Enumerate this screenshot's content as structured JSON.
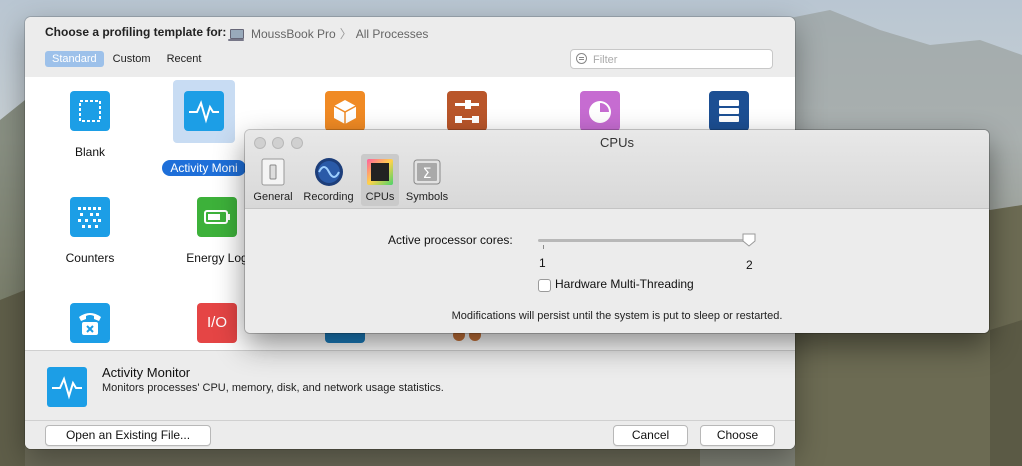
{
  "chooser": {
    "title": "Choose a profiling template for:",
    "device": "MoussBook Pro",
    "process": "All Processes",
    "scope_tabs": [
      "Standard",
      "Custom",
      "Recent"
    ],
    "filter_placeholder": "Filter",
    "templates": [
      {
        "label": "Blank",
        "color": "#1c9ee6",
        "icon": "dashed-square-icon"
      },
      {
        "label": "Activity Monitor",
        "color": "#1c9ee6",
        "icon": "heartbeat-icon",
        "selected_label": "Activity Moni"
      },
      {
        "label": "",
        "color": "#f08a24",
        "icon": "cube-icon"
      },
      {
        "label": "",
        "color": "#b9562a",
        "icon": "sliders-icon"
      },
      {
        "label": "",
        "color": "#c66cd1",
        "icon": "pie-gauge-icon"
      },
      {
        "label": "",
        "color": "#1c4f93",
        "icon": "database-icon"
      },
      {
        "label": "Counters",
        "color": "#1c9ee6",
        "icon": "counters-icon"
      },
      {
        "label": "Energy Log",
        "color": "#3db13a",
        "icon": "battery-icon",
        "shown_label": "Energy Log"
      },
      {
        "label": "",
        "color": "#1c9ee6",
        "icon": "phone-icon"
      },
      {
        "label": "",
        "color": "#e54545",
        "icon": "io-icon",
        "icon_text": "I/O"
      }
    ],
    "description": {
      "title": "Activity Monitor",
      "text": "Monitors processes' CPU, memory, disk, and network usage statistics."
    },
    "buttons": {
      "open": "Open an Existing File...",
      "cancel": "Cancel",
      "choose": "Choose"
    }
  },
  "cpus": {
    "title": "CPUs",
    "tabs": [
      "General",
      "Recording",
      "CPUs",
      "Symbols"
    ],
    "active_tab": "CPUs",
    "cores_label": "Active processor cores:",
    "cores_min": "1",
    "cores_max": "2",
    "cores_value": 2,
    "hw_threading_label": "Hardware Multi-Threading",
    "hw_threading_checked": false,
    "note": "Modifications will persist until the system is put to sleep or restarted."
  }
}
